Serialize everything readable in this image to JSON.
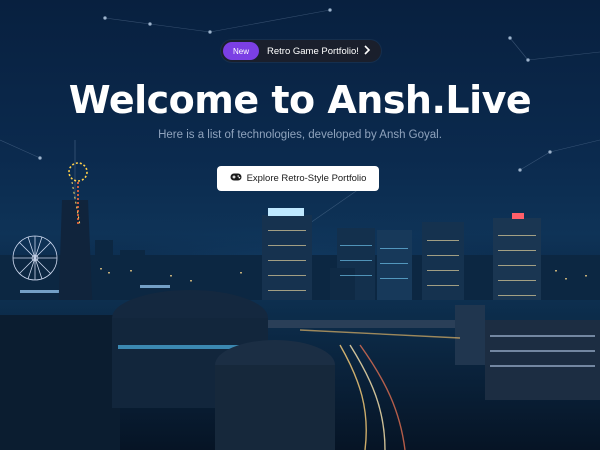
{
  "announcement": {
    "badge": "New",
    "text": "Retro Game Portfolio!",
    "arrow_icon": "chevron-right-icon"
  },
  "hero": {
    "title": "Welcome to Ansh.Live",
    "subtitle": "Here is a list of technologies, developed by Ansh Goyal.",
    "cta_label": "Explore Retro-Style Portfolio",
    "cta_icon": "gamepad-icon"
  },
  "colors": {
    "badge": "#7b3fe4",
    "pill_bg": "#1a1f2c",
    "subtitle": "#8fa3bd",
    "sky_top": "#08203f"
  }
}
